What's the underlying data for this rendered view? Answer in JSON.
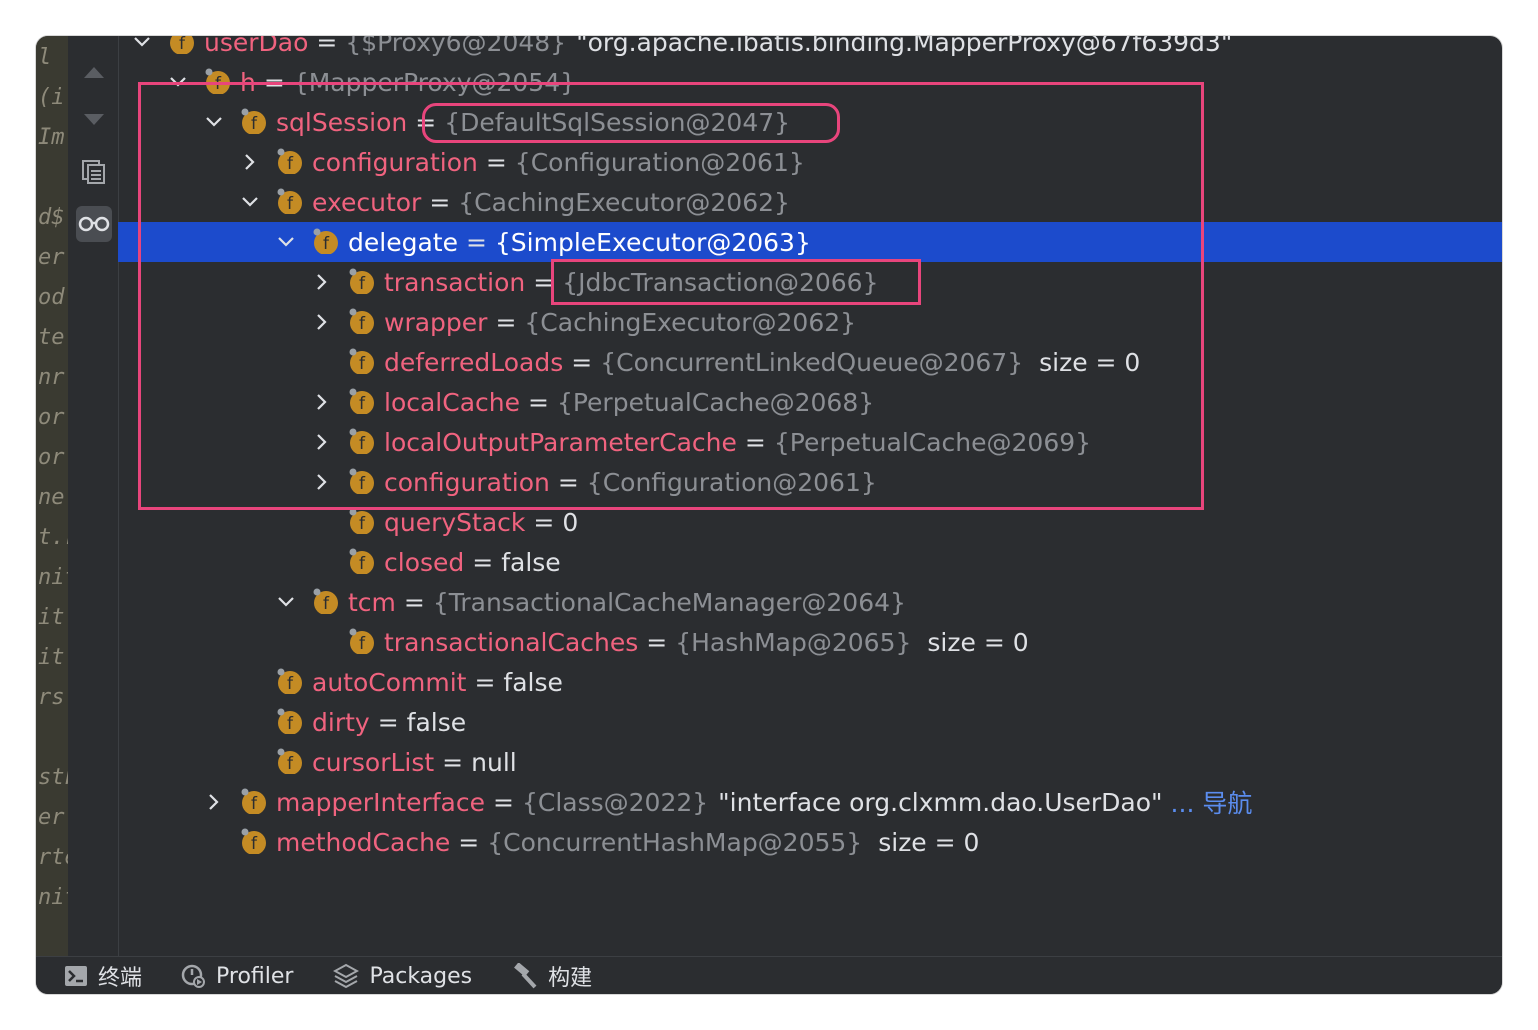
{
  "left_strip_lines": [
    "l (",
    "(i",
    "Im",
    "",
    "d$",
    "er",
    "od",
    "te",
    "nr",
    "or",
    "or",
    "ne",
    "t.r",
    "nit",
    "it.",
    "it.",
    "rs",
    "",
    "stF",
    "er",
    "rte",
    "nit"
  ],
  "tree": [
    {
      "indent": 0,
      "expand": "open",
      "icon": "field-icon",
      "name": "userDao",
      "ref": "{$Proxy6@2048}",
      "value": "\"org.apache.ibatis.binding.MapperProxy@67f639d3\"",
      "clipped": true
    },
    {
      "indent": 1,
      "expand": "open",
      "icon": "field-icon",
      "name": "h",
      "ref": "{MapperProxy@2054}",
      "clipped": true
    },
    {
      "indent": 2,
      "expand": "open",
      "icon": "field-icon",
      "name": "sqlSession",
      "ref": "{DefaultSqlSession@2047}"
    },
    {
      "indent": 3,
      "expand": "closed",
      "icon": "field-icon",
      "name": "configuration",
      "ref": "{Configuration@2061}"
    },
    {
      "indent": 3,
      "expand": "open",
      "icon": "field-icon",
      "name": "executor",
      "ref": "{CachingExecutor@2062}"
    },
    {
      "indent": 4,
      "expand": "open",
      "icon": "field-icon",
      "name": "delegate",
      "ref": "{SimpleExecutor@2063}",
      "selected": true
    },
    {
      "indent": 5,
      "expand": "closed",
      "icon": "field-icon",
      "name": "transaction",
      "ref": "{JdbcTransaction@2066}"
    },
    {
      "indent": 5,
      "expand": "closed",
      "icon": "field-icon",
      "name": "wrapper",
      "ref": "{CachingExecutor@2062}"
    },
    {
      "indent": 5,
      "expand": "none",
      "icon": "field-icon",
      "name": "deferredLoads",
      "ref": "{ConcurrentLinkedQueue@2067}",
      "extra": "size = 0"
    },
    {
      "indent": 5,
      "expand": "closed",
      "icon": "field-icon",
      "name": "localCache",
      "ref": "{PerpetualCache@2068}"
    },
    {
      "indent": 5,
      "expand": "closed",
      "icon": "field-icon",
      "name": "localOutputParameterCache",
      "ref": "{PerpetualCache@2069}"
    },
    {
      "indent": 5,
      "expand": "closed",
      "icon": "field-icon",
      "name": "configuration",
      "ref": "{Configuration@2061}"
    },
    {
      "indent": 5,
      "expand": "none",
      "icon": "field-icon",
      "name": "queryStack",
      "value": "0"
    },
    {
      "indent": 5,
      "expand": "none",
      "icon": "field-icon",
      "name": "closed",
      "value": "false"
    },
    {
      "indent": 4,
      "expand": "open",
      "icon": "field-icon",
      "name": "tcm",
      "ref": "{TransactionalCacheManager@2064}"
    },
    {
      "indent": 5,
      "expand": "none",
      "icon": "field-icon",
      "name": "transactionalCaches",
      "ref": "{HashMap@2065}",
      "extra": "size = 0"
    },
    {
      "indent": 3,
      "expand": "none",
      "icon": "field-icon",
      "name": "autoCommit",
      "value": "false"
    },
    {
      "indent": 3,
      "expand": "none",
      "icon": "field-icon",
      "name": "dirty",
      "value": "false"
    },
    {
      "indent": 3,
      "expand": "none",
      "icon": "field-icon",
      "name": "cursorList",
      "value": "null"
    },
    {
      "indent": 2,
      "expand": "closed",
      "icon": "field-icon",
      "name": "mapperInterface",
      "ref": "{Class@2022}",
      "value": "\"interface org.clxmm.dao.UserDao\"",
      "link": "... 导航"
    },
    {
      "indent": 2,
      "expand": "none",
      "icon": "field-icon",
      "name": "methodCache",
      "ref": "{ConcurrentHashMap@2055}",
      "extra": "size = 0"
    }
  ],
  "toolbar_icons": [
    "up-arrow-icon",
    "down-arrow-icon",
    "copy-icon",
    "glasses-icon"
  ],
  "bottom_bar": [
    {
      "icon": "terminal-icon",
      "label": "终端"
    },
    {
      "icon": "profiler-icon",
      "label": "Profiler"
    },
    {
      "icon": "packages-icon",
      "label": "Packages"
    },
    {
      "icon": "hammer-icon",
      "label": "构建"
    }
  ],
  "colors": {
    "selection": "#1c4bcc",
    "field_name": "#f0637f",
    "annotation": "#e8457c",
    "icon_fill": "#c48b24"
  }
}
